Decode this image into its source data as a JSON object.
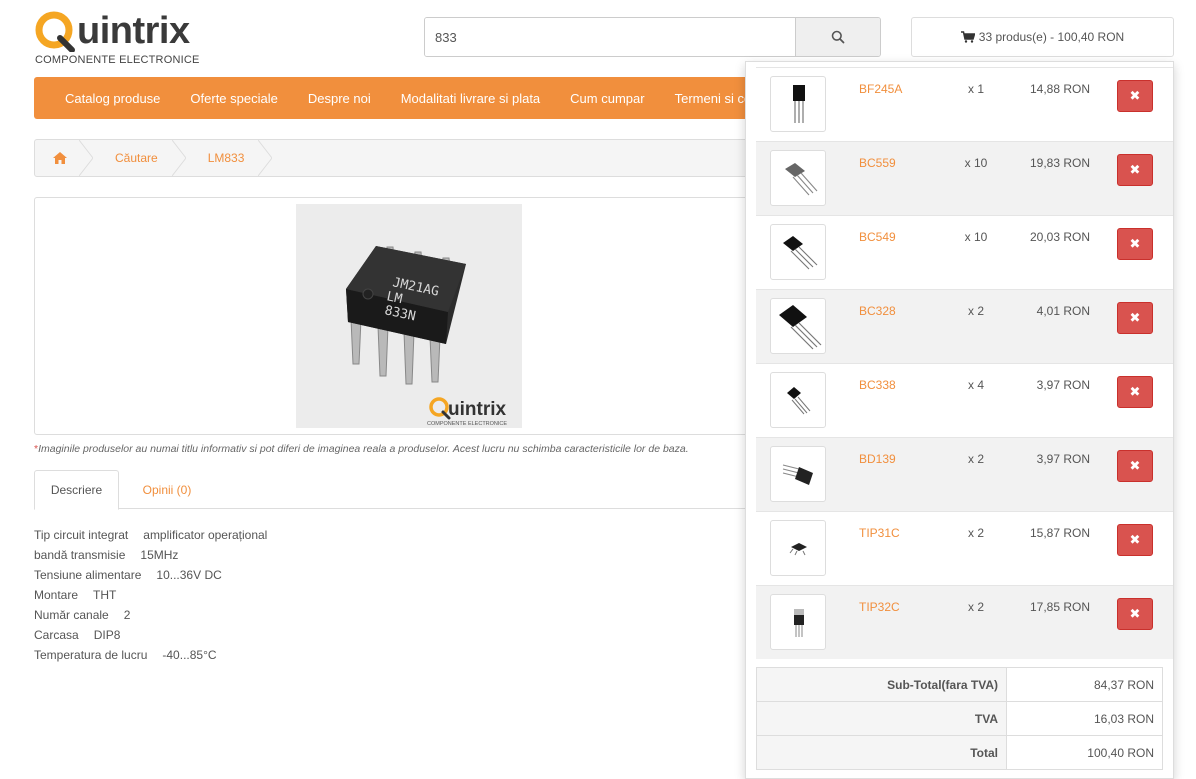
{
  "header": {
    "logo_text": "uintrix",
    "logo_tagline": "COMPONENTE ELECTRONICE",
    "search_value": "833",
    "cart_summary": "33 produs(e) - 100,40 RON"
  },
  "nav": {
    "items": [
      "Catalog produse",
      "Oferte speciale",
      "Despre noi",
      "Modalitati livrare si plata",
      "Cum cumpar",
      "Termeni si conditii"
    ]
  },
  "breadcrumb": {
    "items": [
      "Căutare",
      "LM833"
    ]
  },
  "product": {
    "image_chip_text": [
      "JM21AG",
      "LM",
      "833N"
    ],
    "image_logo": "uintrix",
    "image_logo_tag": "COMPONENTE ELECTRONICE",
    "disclaimer_star": "*",
    "disclaimer": "Imaginile produselor au numai titlu informativ si pot diferi de imaginea reala a produselor. Acest lucru nu schimba caracteristicile lor de baza."
  },
  "tabs": {
    "description": "Descriere",
    "reviews": "Opinii (0)"
  },
  "specs": [
    {
      "label": "Tip circuit integrat",
      "value": "amplificator operațional"
    },
    {
      "label": "bandă transmisie",
      "value": "15MHz"
    },
    {
      "label": "Tensiune alimentare",
      "value": "10...36V DC"
    },
    {
      "label": "Montare",
      "value": "THT"
    },
    {
      "label": "Număr canale",
      "value": "2"
    },
    {
      "label": "Carcasa",
      "value": "DIP8"
    },
    {
      "label": "Temperatura de lucru",
      "value": "-40...85°C"
    }
  ],
  "cart": {
    "items": [
      {
        "name": "BF245A",
        "qty": "x 1",
        "price": "14,88 RON"
      },
      {
        "name": "BC559",
        "qty": "x 10",
        "price": "19,83 RON"
      },
      {
        "name": "BC549",
        "qty": "x 10",
        "price": "20,03 RON"
      },
      {
        "name": "BC328",
        "qty": "x 2",
        "price": "4,01 RON"
      },
      {
        "name": "BC338",
        "qty": "x 4",
        "price": "3,97 RON"
      },
      {
        "name": "BD139",
        "qty": "x 2",
        "price": "3,97 RON"
      },
      {
        "name": "TIP31C",
        "qty": "x 2",
        "price": "15,87 RON"
      },
      {
        "name": "TIP32C",
        "qty": "x 2",
        "price": "17,85 RON"
      }
    ],
    "remove_symbol": "✖",
    "subtotal_label": "Sub-Total(fara TVA)",
    "subtotal_value": "84,37 RON",
    "vat_label": "TVA",
    "vat_value": "16,03 RON",
    "total_label": "Total",
    "total_value": "100,40 RON"
  },
  "colors": {
    "accent": "#f18f3d",
    "danger": "#d9534f"
  },
  "icons": [
    "home-icon",
    "search-icon",
    "cart-icon",
    "remove-icon"
  ]
}
